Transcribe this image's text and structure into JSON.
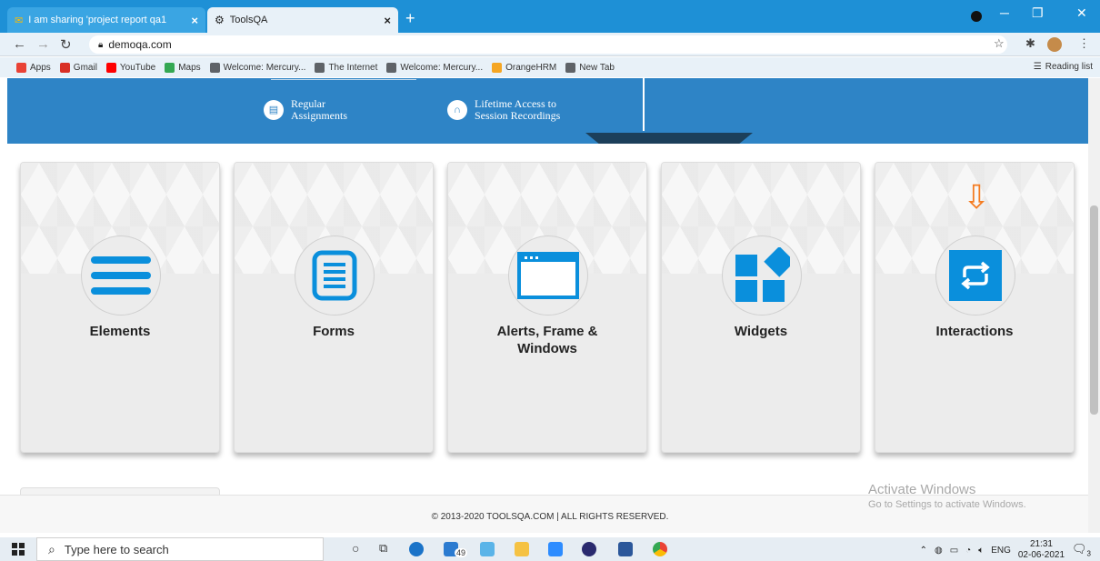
{
  "browser": {
    "tabs": [
      {
        "title": "I am sharing 'project report qa1",
        "close": "×"
      },
      {
        "title": "ToolsQA",
        "close": "×"
      }
    ],
    "new_tab": "+",
    "window_controls": {
      "minimize": "─",
      "restore": "❐",
      "close": "✕"
    },
    "url": "demoqa.com",
    "bookmarks": [
      {
        "label": "Apps",
        "color": "#e94235"
      },
      {
        "label": "Gmail",
        "color": "#d93025"
      },
      {
        "label": "YouTube",
        "color": "#ff0000"
      },
      {
        "label": "Maps",
        "color": "#34a853"
      },
      {
        "label": "Welcome: Mercury...",
        "color": "#5f6368"
      },
      {
        "label": "The Internet",
        "color": "#5f6368"
      },
      {
        "label": "Welcome: Mercury...",
        "color": "#5f6368"
      },
      {
        "label": "OrangeHRM",
        "color": "#f5a623"
      },
      {
        "label": "New Tab",
        "color": "#5f6368"
      }
    ],
    "reading_list": "Reading list"
  },
  "banner": {
    "features": [
      {
        "line1": "Regular",
        "line2": "Assignments",
        "icon": "document-icon"
      },
      {
        "line1": "Lifetime Access to",
        "line2": "Session Recordings",
        "icon": "headphones-icon"
      }
    ],
    "accent_color": "#2e84c6"
  },
  "cards": [
    {
      "label": "Elements",
      "label2": "",
      "icon": "hamburger-icon"
    },
    {
      "label": "Forms",
      "label2": "",
      "icon": "form-icon"
    },
    {
      "label": "Alerts, Frame &",
      "label2": "Windows",
      "icon": "window-icon"
    },
    {
      "label": "Widgets",
      "label2": "",
      "icon": "widgets-icon"
    },
    {
      "label": "Interactions",
      "label2": "",
      "icon": "arrows-icon"
    }
  ],
  "annotation": {
    "arrow": "⇩",
    "color": "#f47b20"
  },
  "footer": {
    "text": "© 2013-2020 TOOLSQA.COM | ALL RIGHTS RESERVED."
  },
  "watermark": {
    "title": "Activate Windows",
    "subtitle": "Go to Settings to activate Windows."
  },
  "taskbar": {
    "search_placeholder": "Type here to search",
    "badge": "49",
    "language": "ENG",
    "time": "21:31",
    "date": "02-06-2021",
    "notifications": "3"
  }
}
